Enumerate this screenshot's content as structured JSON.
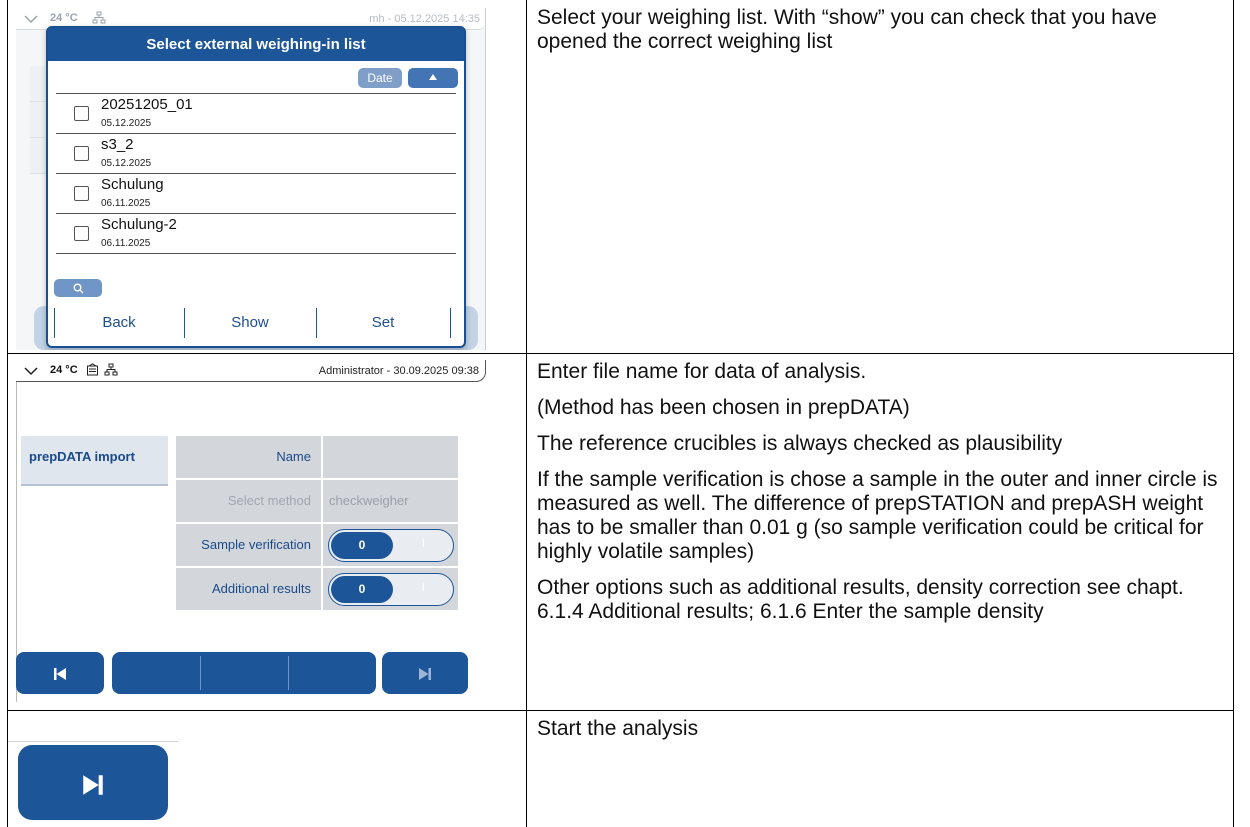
{
  "row1": {
    "description": "Select your weighing list. With “show” you can check that you have opened the correct weighing list",
    "screen": {
      "status_temp": "24 °C",
      "status_user": "mh - 05.12.2025 14:35",
      "dialog_title": "Select external weighing-in list",
      "sort_label": "Date",
      "items": [
        {
          "name": "20251205_01",
          "date": "05.12.2025"
        },
        {
          "name": "s3_2",
          "date": "05.12.2025"
        },
        {
          "name": "Schulung",
          "date": "06.11.2025"
        },
        {
          "name": "Schulung-2",
          "date": "06.11.2025"
        }
      ],
      "buttons": {
        "back": "Back",
        "show": "Show",
        "set": "Set"
      }
    }
  },
  "row2": {
    "description": [
      "Enter file name for data of analysis.",
      "(Method has been chosen in prepDATA)",
      "The reference crucibles is always checked as plausibility",
      "If the sample verification is chose a sample in the outer and inner circle is measured as well. The difference of prepSTATION and prepASH weight has to be smaller than 0.01 g (so sample verification could be critical for highly volatile samples)",
      "Other options such as additional results, density correction see chapt. 6.1.4 Additional results; 6.1.6 Enter the sample density"
    ],
    "screen": {
      "status_temp": "24 °C",
      "status_user": "Administrator - 30.09.2025 09:38",
      "side_tab": "prepDATA import",
      "fields": {
        "name_label": "Name",
        "name_value": "",
        "method_label": "Select method",
        "method_value": "checkweigher",
        "verification_label": "Sample verification",
        "verification_value": "0",
        "verification_off": "I",
        "additional_label": "Additional results",
        "additional_value": "0",
        "additional_off": "I"
      }
    }
  },
  "row3": {
    "description": "Start the analysis"
  },
  "colors": {
    "accent": "#1d5599",
    "dialog_header": "#1d5599",
    "field_bg": "#d3d7dc"
  },
  "icons": [
    "chevron-down-icon",
    "network-icon",
    "document-icon",
    "search-icon",
    "caret-up-icon",
    "skip-back-icon",
    "skip-forward-icon"
  ]
}
